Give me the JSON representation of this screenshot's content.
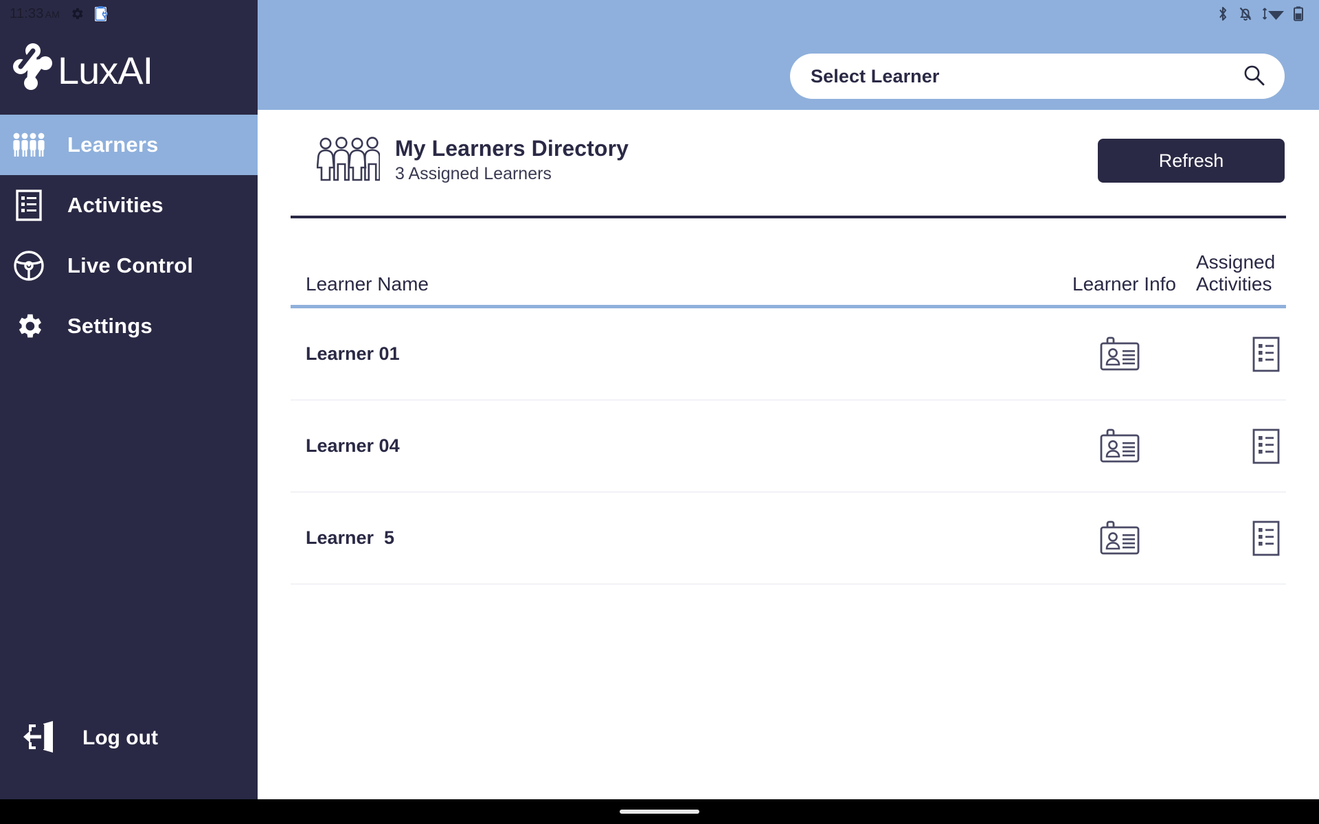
{
  "status_bar": {
    "time": "11:33",
    "ampm": "AM",
    "left_icons": [
      "gear-icon",
      "clipboard-device-icon"
    ],
    "right_icons": [
      "bluetooth-icon",
      "notifications-muted-icon",
      "wifi-icon",
      "battery-icon"
    ]
  },
  "brand": {
    "name": "LuxAI",
    "logo": "luxai-molecule-logo"
  },
  "sidebar": {
    "items": [
      {
        "label": "Learners",
        "icon": "group-people-icon",
        "active": true
      },
      {
        "label": "Activities",
        "icon": "checklist-icon",
        "active": false
      },
      {
        "label": "Live Control",
        "icon": "steering-wheel-icon",
        "active": false
      },
      {
        "label": "Settings",
        "icon": "gear-icon",
        "active": false
      }
    ],
    "logout": {
      "label": "Log out",
      "icon": "logout-door-icon"
    }
  },
  "topbar": {
    "search": {
      "text": "Select Learner",
      "placeholder": "Select Learner",
      "icon": "search-icon"
    }
  },
  "directory": {
    "icon": "four-people-group-icon",
    "title": "My Learners Directory",
    "subtitle": "3 Assigned Learners",
    "refresh_label": "Refresh"
  },
  "table": {
    "columns": [
      "Learner Name",
      "Learner Info",
      "Assigned Activities"
    ],
    "rows": [
      {
        "name": "Learner 01",
        "info_icon": "id-badge-icon",
        "activities_icon": "checklist-icon"
      },
      {
        "name": "Learner 04",
        "info_icon": "id-badge-icon",
        "activities_icon": "checklist-icon"
      },
      {
        "name": "Learner  5",
        "info_icon": "id-badge-icon",
        "activities_icon": "checklist-icon"
      }
    ]
  },
  "colors": {
    "sidebar_bg": "#2a2945",
    "accent_blue": "#8fb0dc",
    "text_dark": "#2a2945",
    "row_divider": "#e6e8ef"
  }
}
